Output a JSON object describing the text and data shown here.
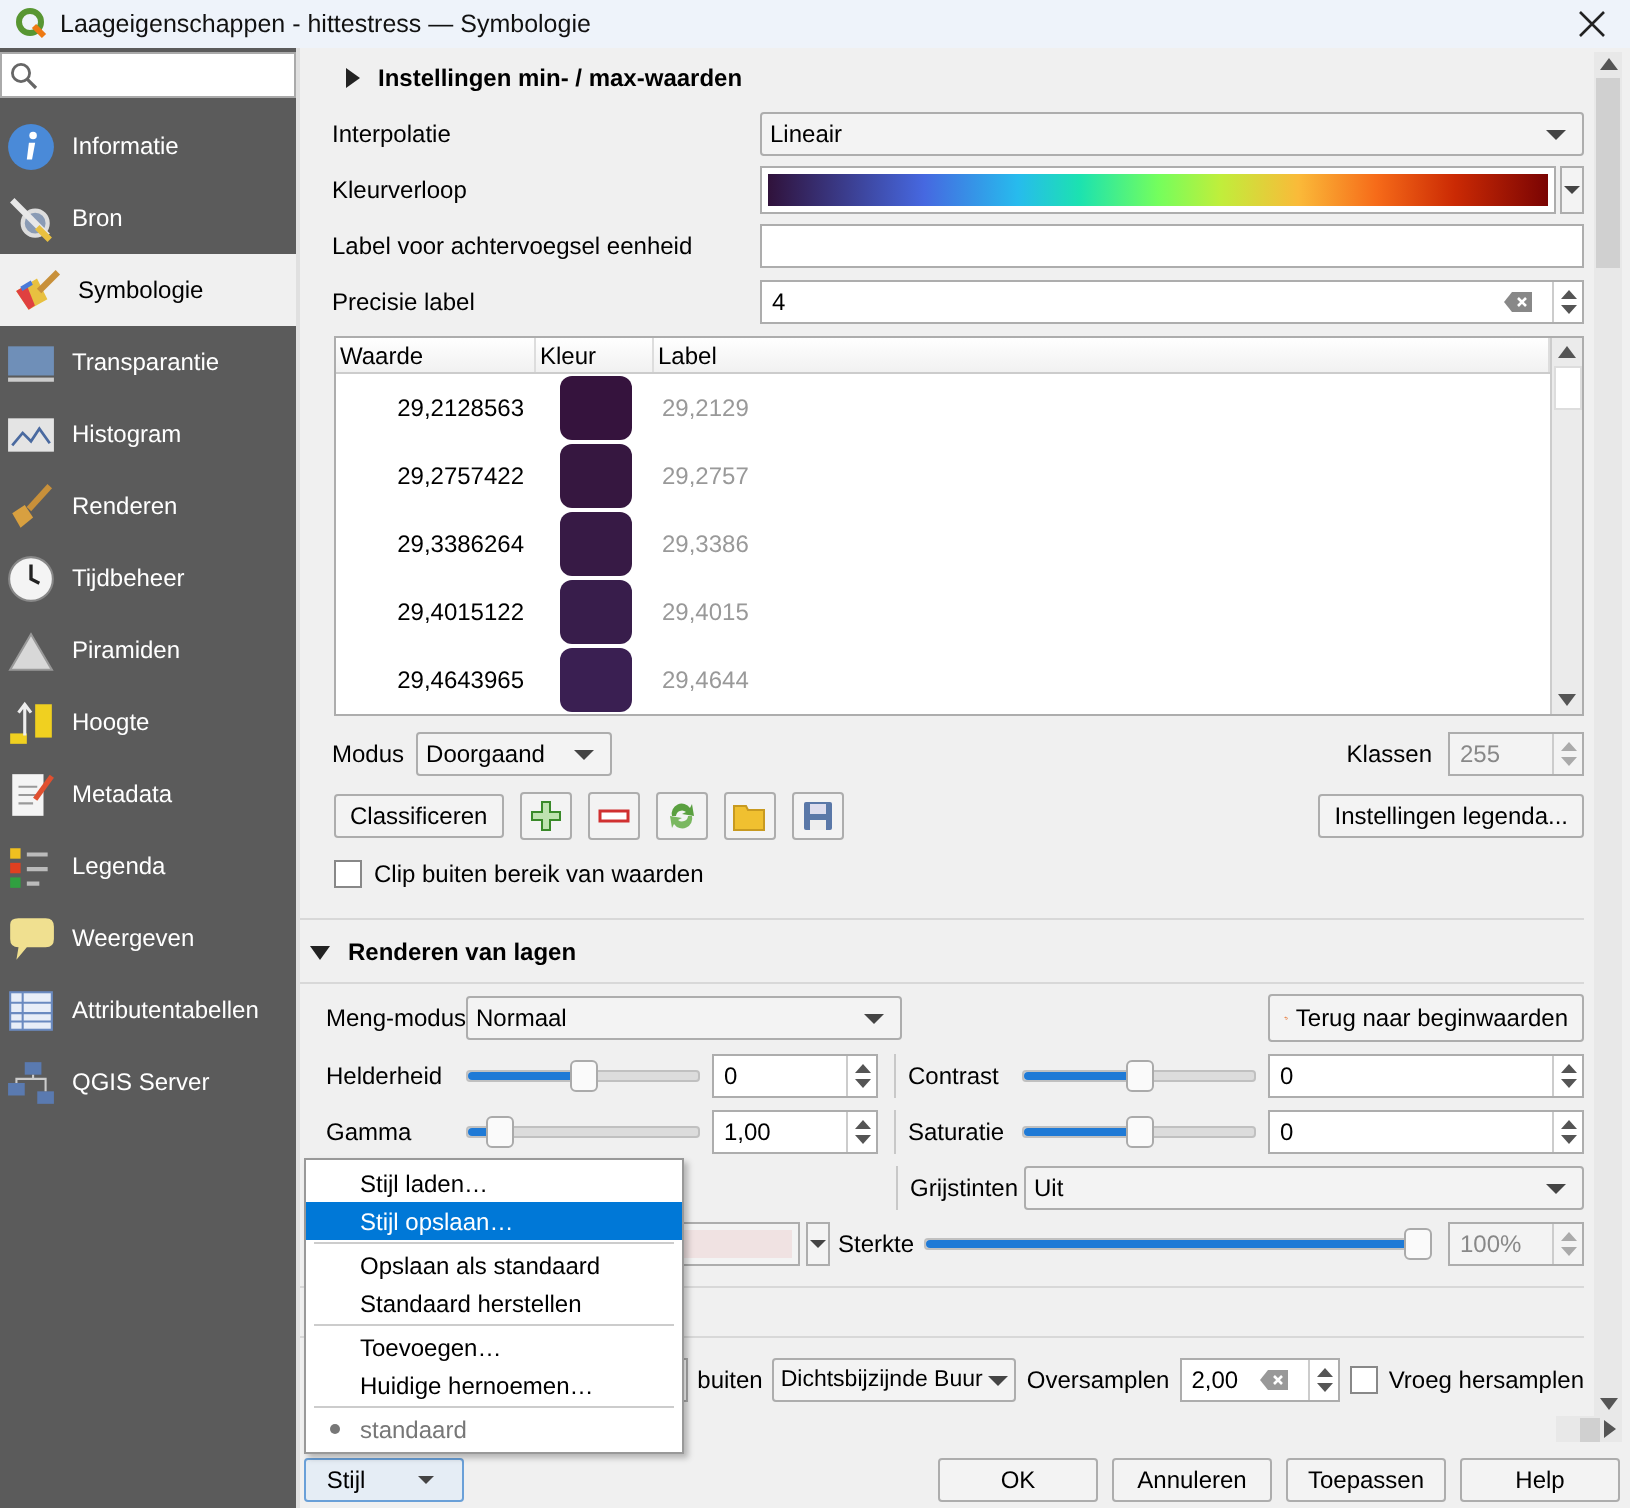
{
  "window": {
    "title": "Laageigenschappen - hittestress — Symbologie"
  },
  "sidebar": {
    "items": [
      {
        "label": "Informatie",
        "selected": false,
        "kind": "info"
      },
      {
        "label": "Bron",
        "selected": false,
        "kind": "source"
      },
      {
        "label": "Symbologie",
        "selected": true,
        "kind": "symbology"
      },
      {
        "label": "Transparantie",
        "selected": false,
        "kind": "transparency"
      },
      {
        "label": "Histogram",
        "selected": false,
        "kind": "histogram"
      },
      {
        "label": "Renderen",
        "selected": false,
        "kind": "rendering"
      },
      {
        "label": "Tijdbeheer",
        "selected": false,
        "kind": "temporal"
      },
      {
        "label": "Piramiden",
        "selected": false,
        "kind": "pyramids"
      },
      {
        "label": "Hoogte",
        "selected": false,
        "kind": "elevation"
      },
      {
        "label": "Metadata",
        "selected": false,
        "kind": "metadata"
      },
      {
        "label": "Legenda",
        "selected": false,
        "kind": "legend"
      },
      {
        "label": "Weergeven",
        "selected": false,
        "kind": "display"
      },
      {
        "label": "Attributentabellen",
        "selected": false,
        "kind": "attributes"
      },
      {
        "label": "QGIS Server",
        "selected": false,
        "kind": "server"
      }
    ]
  },
  "minmax_section": {
    "title": "Instellingen min- / max-waarden",
    "expanded": false
  },
  "interpolation": {
    "label": "Interpolatie",
    "value": "Lineair"
  },
  "color_ramp": {
    "label": "Kleurverloop"
  },
  "suffix": {
    "label": "Label voor achtervoegsel eenheid"
  },
  "precision": {
    "label": "Precisie label",
    "value": "4"
  },
  "table": {
    "columns": [
      "Waarde",
      "Kleur",
      "Label"
    ],
    "rows": [
      {
        "value": "29,2128563",
        "color": "#35133d",
        "label": "29,2129"
      },
      {
        "value": "29,2757422",
        "color": "#361740",
        "label": "29,2757"
      },
      {
        "value": "29,3386264",
        "color": "#371a45",
        "label": "29,3386"
      },
      {
        "value": "29,4015122",
        "color": "#381d4b",
        "label": "29,4015"
      },
      {
        "value": "29,4643965",
        "color": "#3a1f52",
        "label": "29,4644"
      }
    ]
  },
  "mode": {
    "label": "Modus",
    "value": "Doorgaand"
  },
  "classes": {
    "label": "Klassen",
    "value": "255",
    "disabled": true
  },
  "classify_button": "Classificeren",
  "legend_button": "Instellingen legenda...",
  "clip": {
    "label": "Clip buiten bereik van waarden",
    "checked": false
  },
  "render_section": {
    "title": "Renderen van lagen",
    "expanded": true
  },
  "blend": {
    "label": "Meng-modus",
    "value": "Normaal"
  },
  "reset_button": "Terug naar beginwaarden",
  "adjustments": [
    {
      "label": "Helderheid",
      "level": 0.5,
      "value": "0"
    },
    {
      "label": "Contrast",
      "level": 0.5,
      "value": "0"
    },
    {
      "label": "Gamma",
      "level": 0.1,
      "value": "1,00"
    },
    {
      "label": "Saturatie",
      "level": 0.5,
      "value": "0"
    }
  ],
  "grayscale": {
    "label": "Grijstinten",
    "value": "Uit"
  },
  "strength": {
    "label": "Sterkte",
    "level": 1,
    "value": "100%",
    "disabled": true
  },
  "resampling": {
    "label": "buiten",
    "value": "Dichtsbijzijnde Buur"
  },
  "oversampling": {
    "label": "Oversamplen",
    "value": "2,00"
  },
  "early_resampling": {
    "label": "Vroeg hersamplen",
    "checked": false
  },
  "style_menu": {
    "groups": [
      [
        {
          "label": "Stijl laden…",
          "selected": false,
          "kind": "action"
        },
        {
          "label": "Stijl opslaan…",
          "selected": true,
          "kind": "action"
        }
      ],
      [
        {
          "label": "Opslaan als standaard",
          "selected": false,
          "kind": "action"
        },
        {
          "label": "Standaard herstellen",
          "selected": false,
          "kind": "action"
        }
      ],
      [
        {
          "label": "Toevoegen…",
          "selected": false,
          "kind": "action"
        },
        {
          "label": "Huidige hernoemen…",
          "selected": false,
          "kind": "action"
        }
      ],
      [
        {
          "label": "standaard",
          "selected": false,
          "kind": "style"
        }
      ]
    ]
  },
  "style_button": "Stijl",
  "dialog_buttons": [
    "OK",
    "Annuleren",
    "Toepassen",
    "Help"
  ]
}
